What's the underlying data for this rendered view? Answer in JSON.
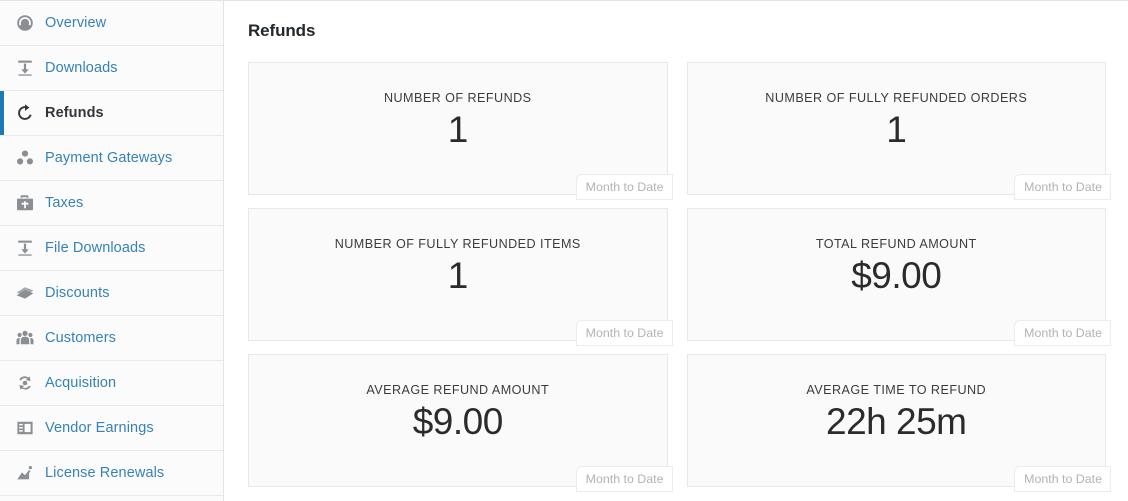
{
  "sidebar": {
    "items": [
      {
        "label": "Overview",
        "icon": "dashboard-icon",
        "active": false
      },
      {
        "label": "Downloads",
        "icon": "download-icon",
        "active": false
      },
      {
        "label": "Refunds",
        "icon": "undo-arrow-icon",
        "active": true
      },
      {
        "label": "Payment Gateways",
        "icon": "group-dots-icon",
        "active": false
      },
      {
        "label": "Taxes",
        "icon": "portfolio-icon",
        "active": false
      },
      {
        "label": "File Downloads",
        "icon": "download-box-icon",
        "active": false
      },
      {
        "label": "Discounts",
        "icon": "tickets-icon",
        "active": false
      },
      {
        "label": "Customers",
        "icon": "users-icon",
        "active": false
      },
      {
        "label": "Acquisition",
        "icon": "update-circle-icon",
        "active": false
      },
      {
        "label": "Vendor Earnings",
        "icon": "media-list-icon",
        "active": false
      },
      {
        "label": "License Renewals",
        "icon": "chart-area-icon",
        "active": false
      }
    ],
    "active_accent_color": "#1b7cb5",
    "link_color": "#3582b8"
  },
  "main": {
    "title": "Refunds",
    "tiles": [
      {
        "label": "NUMBER OF REFUNDS",
        "value": "1",
        "badge": "Month to Date"
      },
      {
        "label": "NUMBER OF FULLY REFUNDED ORDERS",
        "value": "1",
        "badge": "Month to Date"
      },
      {
        "label": "NUMBER OF FULLY REFUNDED ITEMS",
        "value": "1",
        "badge": "Month to Date"
      },
      {
        "label": "TOTAL REFUND AMOUNT",
        "value": "$9.00",
        "badge": "Month to Date"
      },
      {
        "label": "AVERAGE REFUND AMOUNT",
        "value": "$9.00",
        "badge": "Month to Date"
      },
      {
        "label": "AVERAGE TIME TO REFUND",
        "value": "22h 25m",
        "badge": "Month to Date"
      }
    ]
  }
}
